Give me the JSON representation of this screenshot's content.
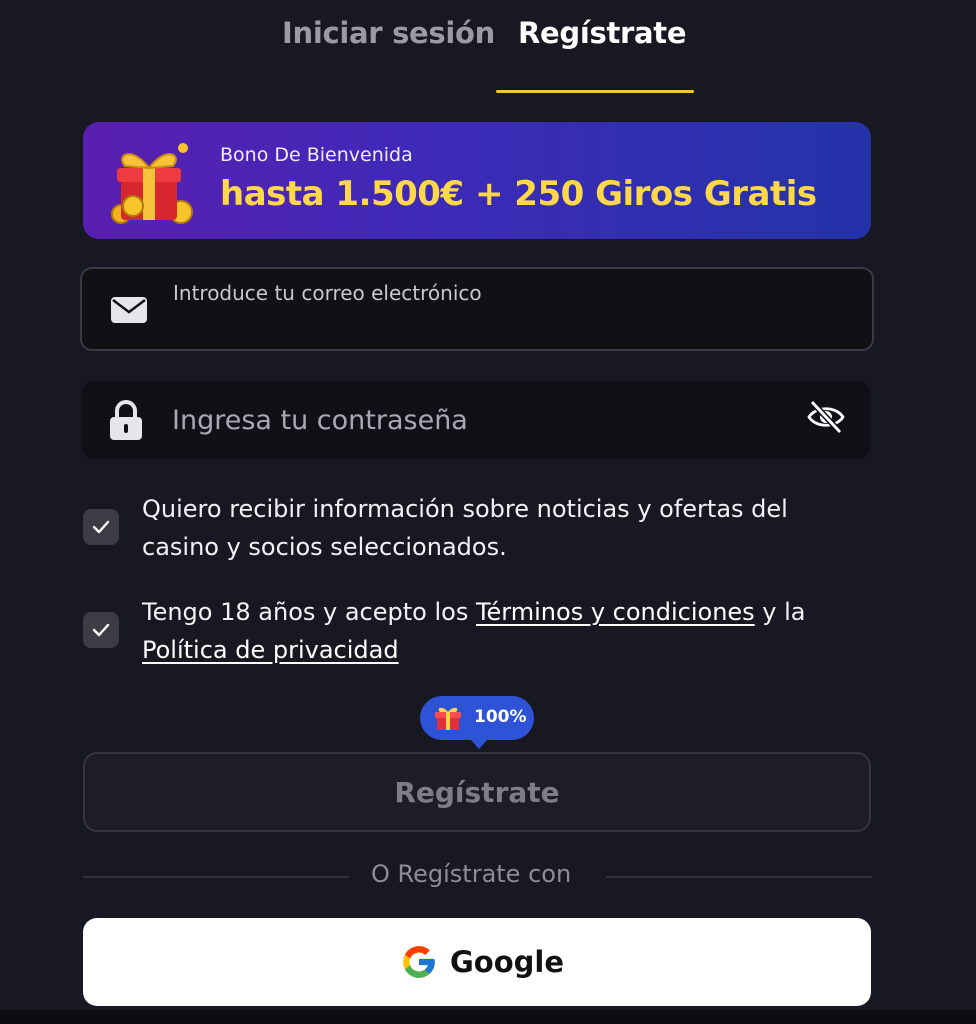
{
  "tabs": {
    "login_label": "Iniciar sesión",
    "register_label": "Regístrate",
    "active": "register"
  },
  "banner": {
    "subtitle": "Bono De Bienvenida",
    "title": "hasta 1.500€ + 250 Giros Gratis",
    "icon": "gift-box-icon"
  },
  "form": {
    "email_label": "Introduce tu correo electrónico",
    "email_value": "",
    "password_placeholder": "Ingresa tu contraseña",
    "password_value": "",
    "consent_news": {
      "checked": true,
      "text": "Quiero recibir información sobre noticias y ofertas del casino y socios seleccionados."
    },
    "consent_terms": {
      "checked": true,
      "prefix": "Tengo 18 años y acepto los ",
      "terms_link": "Términos y condiciones",
      "middle": " y la ",
      "privacy_link": "Política de privacidad"
    }
  },
  "badge": {
    "text": "100%",
    "icon": "gift-icon"
  },
  "register_button_label": "Regístrate",
  "divider_text": "O Regístrate con",
  "google_button_label": "Google",
  "colors": {
    "background": "#181822",
    "accent_underline": "#f6c23a",
    "banner_title": "#ffd84a",
    "badge": "#2f53d6"
  }
}
